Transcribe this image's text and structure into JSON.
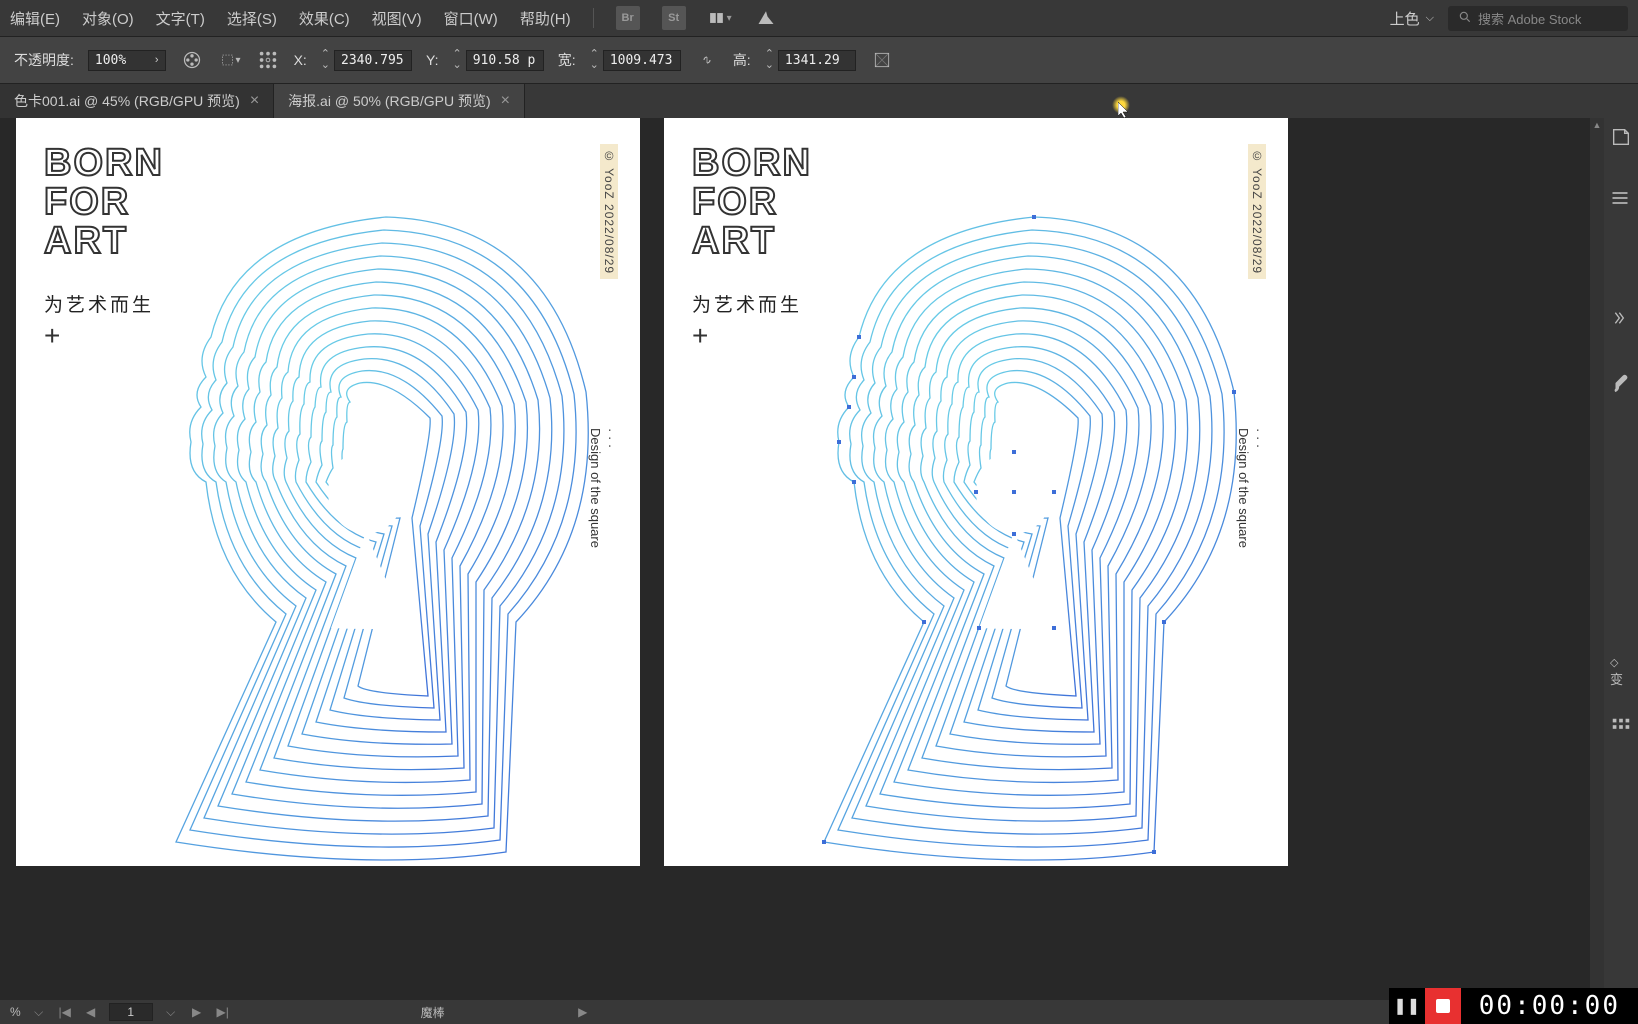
{
  "menubar": {
    "items": [
      "编辑(E)",
      "对象(O)",
      "文字(T)",
      "选择(S)",
      "效果(C)",
      "视图(V)",
      "窗口(W)",
      "帮助(H)"
    ],
    "bridge_icon": "Br",
    "stock_icon": "St",
    "workspace": "上色",
    "search_placeholder": "搜索 Adobe Stock"
  },
  "controlbar": {
    "opacity_label": "不透明度:",
    "opacity_value": "100%",
    "x_label": "X:",
    "x_value": "2340.795",
    "y_label": "Y:",
    "y_value": "910.58 p",
    "w_label": "宽:",
    "w_value": "1009.473",
    "h_label": "高:",
    "h_value": "1341.29"
  },
  "tabs": [
    {
      "label": "色卡001.ai @ 45% (RGB/GPU 预览)",
      "active": false
    },
    {
      "label": "海报.ai @ 50% (RGB/GPU 预览)",
      "active": true
    }
  ],
  "poster": {
    "title_line1": "BORN",
    "title_line2": "FOR",
    "title_line3": "ART",
    "subtitle": "为艺术而生",
    "plus": "+",
    "watermark": "© YooZ  2022/08/29",
    "sidetext_dots": "·  ·  ·",
    "sidetext": "Design of the square"
  },
  "statusbar": {
    "zoom": "%",
    "page": "1",
    "tool": "魔棒"
  },
  "recorder": {
    "time": "00:00:00"
  },
  "rightdock": {
    "transform_label": "变"
  }
}
